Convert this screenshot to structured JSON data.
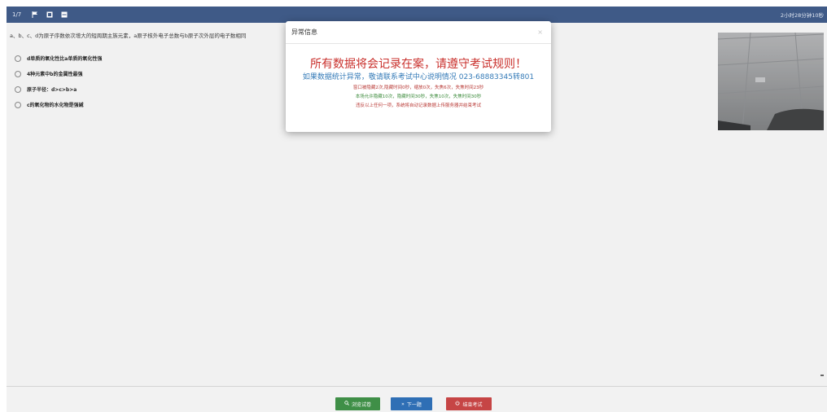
{
  "topbar": {
    "question_index": "1/7",
    "icons": [
      "flag-icon",
      "square-icon",
      "square-icon"
    ],
    "timer": "2小时28分钟10秒"
  },
  "question": {
    "text": "a、b、c、d为原子序数依次增大的短周期主族元素，a原子核外电子总数与b原子次外层的电子数相同",
    "options": [
      "d单质的氧化性比a单质的氧化性强",
      "4种元素中b的金属性最强",
      "原子半径：d>c>b>a",
      "c的氧化物的水化物是强碱"
    ]
  },
  "modal": {
    "title": "异常信息",
    "close": "×",
    "headline": "所有数据将会记录在案，请遵守考试规则！",
    "contact": "如果数据统计异常，敬请联系考试中心说明情况 023-68883345转801",
    "line1": "窗口被隐藏2次,隐藏时间0秒，缩放0次，失焦6次，失焦时间23秒",
    "line2": "本场允许隐藏10次，隐藏时间30秒，失焦10次，失焦时间30秒",
    "line3": "违反以上任何一项，系统将自动记录数据上传服务器并结束考试"
  },
  "buttons": {
    "browse": "浏览试卷",
    "next": "下一题",
    "end": "结束考试"
  },
  "colors": {
    "topbar": "#3f5a87",
    "headline": "#c9302c",
    "contact": "#337ab7",
    "browse": "#3f8f47",
    "next": "#2f6fb5",
    "end": "#c64545"
  }
}
